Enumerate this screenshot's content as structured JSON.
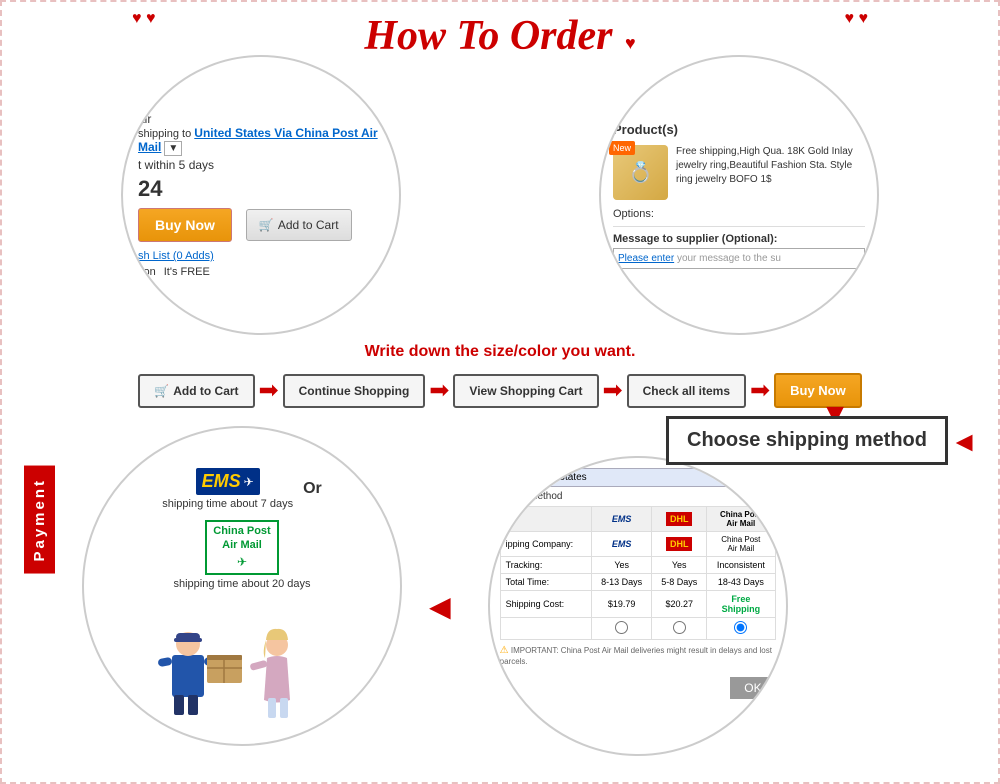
{
  "page": {
    "title": "How To Order",
    "border_color": "#e8c0c0"
  },
  "decorations": {
    "hearts_left": "♥ ♥",
    "hearts_right": "♥ ♥",
    "heart_small": "♥"
  },
  "top_left_circle": {
    "shipping_label": "shipping to",
    "shipping_link": "United States Via China Post Air Mail",
    "dropdown_indicator": "▼",
    "within_days": "t within 5 days",
    "price": "24",
    "buy_now_label": "Buy Now",
    "add_to_cart_label": "Add to Cart",
    "cart_icon": "🛒",
    "wishlist_label": "sh List (0 Adds)",
    "tion_label": "tion",
    "free_label": "It's FREE",
    "air_label": "air"
  },
  "top_right_circle": {
    "products_header": "Product(s)",
    "new_badge": "New",
    "product_description": "Free shipping,High Qua. 18K Gold Inlay jewelry ring,Beautiful Fashion Sta. Style ring jewelry BOFO 1$",
    "options_label": "Options:",
    "message_label": "Message to supplier (Optional):",
    "message_placeholder": "Please enter your message to the su"
  },
  "write_down_text": "Write down the size/color you want.",
  "steps": [
    {
      "id": "add-to-cart",
      "label": "Add to Cart",
      "has_icon": true
    },
    {
      "id": "continue-shopping",
      "label": "Continue Shopping",
      "has_icon": false
    },
    {
      "id": "view-shopping-cart",
      "label": "View Shopping Cart",
      "has_icon": false
    },
    {
      "id": "check-all-items",
      "label": "Check all items",
      "has_icon": false
    },
    {
      "id": "buy-now",
      "label": "Buy Now",
      "has_icon": false,
      "highlighted": true
    }
  ],
  "arrows": {
    "right_arrow": "➡",
    "left_arrow": "←",
    "down_arrow": "↓",
    "bold_right": "⟹"
  },
  "choose_shipping": {
    "label": "Choose shipping method",
    "arrow_left": "◄"
  },
  "payment_tab": {
    "label": "Payment"
  },
  "bottom_left_circle": {
    "ems_label": "EMS",
    "or_label": "Or",
    "china_post_label": "China Post\nAir Mail",
    "ems_shipping_time": "shipping time about 7 days",
    "china_post_shipping_time": "shipping time about 20 days"
  },
  "shipping_table": {
    "header_row": [
      "",
      "EMS",
      "DHL",
      "China Post\nAir Mail"
    ],
    "rows": [
      {
        "label": "Shipping Company:",
        "ems": "EMS",
        "dhl": "DHL",
        "china": "China Post\nAir Mail"
      },
      {
        "label": "Tracking:",
        "ems": "Yes",
        "dhl": "Yes",
        "china": "Inconsistent"
      },
      {
        "label": "Total Time:",
        "ems": "8-13 Days",
        "dhl": "5-8 Days",
        "china": "18-43 Days"
      },
      {
        "label": "Shipping Cost:",
        "ems": "$19.79",
        "dhl": "$20.27",
        "china": "Free\nShipping"
      }
    ],
    "important_note": "IMPORTANT: China Post Air Mail deliveries might result in delays and lost parcels.",
    "ok_button": "OK",
    "us_label": "United States",
    "shipping_method_label": "Shipping Method",
    "ipping_label": "ipping Method",
    "ipping_company_label": "ipping Company:"
  }
}
